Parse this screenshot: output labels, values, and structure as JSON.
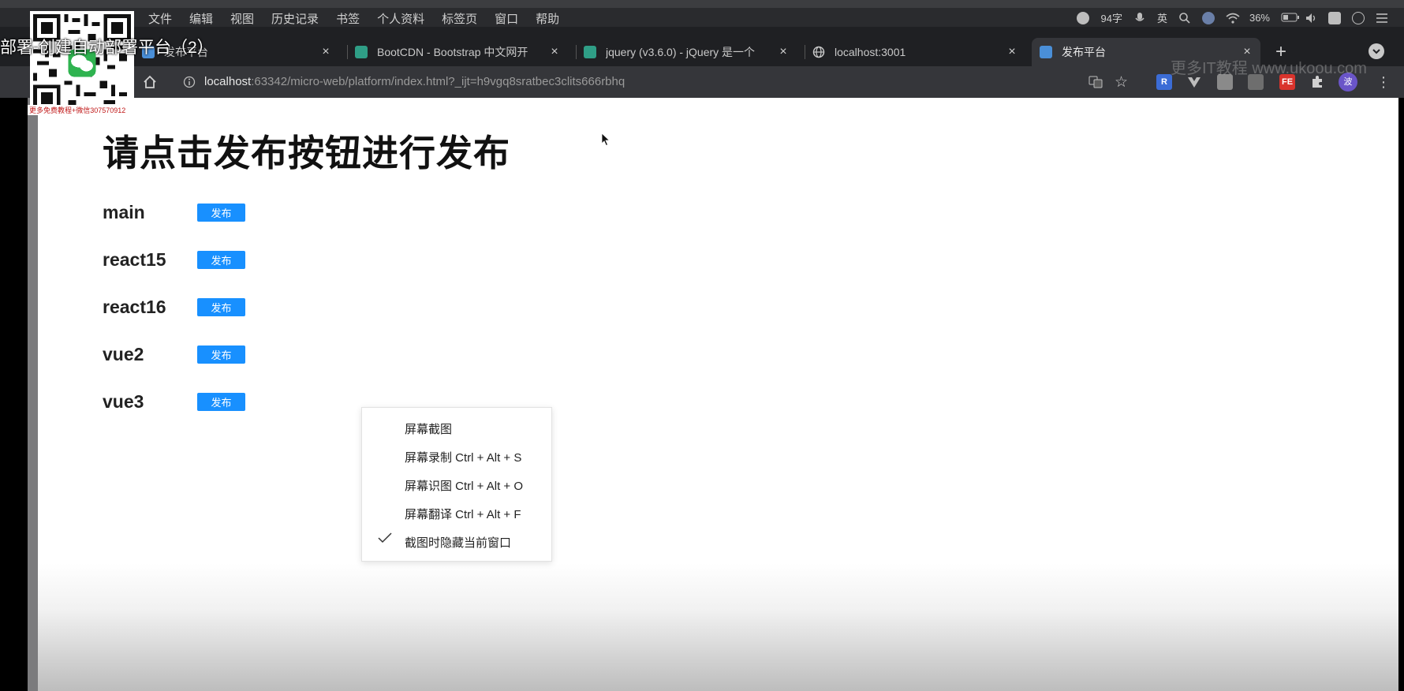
{
  "menubar": {
    "items": [
      "文件",
      "编辑",
      "视图",
      "历史记录",
      "书签",
      "个人资料",
      "标签页",
      "窗口",
      "帮助"
    ],
    "word_count": "94字",
    "input_method": "英",
    "battery": "36%"
  },
  "tabs": [
    {
      "title": "发布平台",
      "active": false
    },
    {
      "title": "BootCDN - Bootstrap 中文网开",
      "active": false
    },
    {
      "title": "jquery (v3.6.0) - jQuery 是一个",
      "active": false
    },
    {
      "title": "localhost:3001",
      "active": false
    },
    {
      "title": "发布平台",
      "active": true
    }
  ],
  "address": {
    "host": "localhost",
    "rest": ":63342/micro-web/platform/index.html?_ijt=h9vgq8sratbec3clits666rbhq"
  },
  "extensions": [
    {
      "label": "R",
      "color": "#3b6cd6"
    },
    {
      "label": "",
      "color": "#5a5a5a"
    },
    {
      "label": "",
      "color": "#5a5a5a"
    },
    {
      "label": "",
      "color": "#5a5a5a"
    },
    {
      "label": "FE",
      "color": "#d9332c"
    },
    {
      "label": "",
      "color": "#5a5a5a"
    }
  ],
  "profile_initial": "波",
  "watermark": "更多IT教程 www.ukoou.com",
  "page": {
    "heading": "请点击发布按钮进行发布",
    "button_label": "发布",
    "apps": [
      "main",
      "react15",
      "react16",
      "vue2",
      "vue3"
    ]
  },
  "context_menu": {
    "items": [
      "屏幕截图",
      "屏幕录制 Ctrl + Alt + S",
      "屏幕识图 Ctrl + Alt + O",
      "屏幕翻译 Ctrl + Alt + F",
      "截图时隐藏当前窗口"
    ],
    "checked_index": 4
  },
  "overlay": {
    "video_title": "部署-创建自动部署平台（2）",
    "qr_caption": "更多免费教程+微信307570912"
  },
  "colors": {
    "publish_button": "#1890ff",
    "tab_strip": "#1f2023",
    "active_tab": "#35363a"
  }
}
